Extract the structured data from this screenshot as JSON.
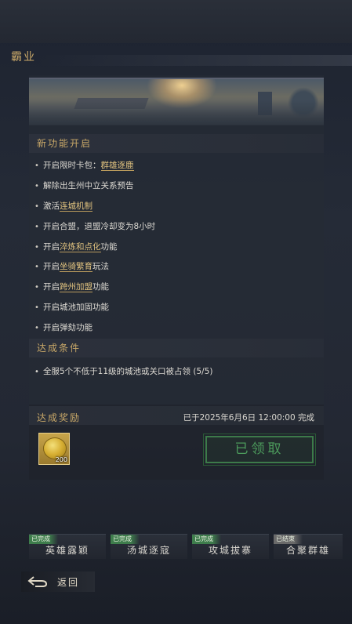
{
  "page": {
    "title": "霸业"
  },
  "features": {
    "heading": "新功能开启",
    "items": [
      {
        "text": "开启限时卡包：",
        "highlight": "群雄逐鹿",
        "suffix": ""
      },
      {
        "text": "解除出生州中立关系预告",
        "highlight": "",
        "suffix": ""
      },
      {
        "text": "激活",
        "highlight": "连城机制",
        "suffix": ""
      },
      {
        "text": "开启合盟，退盟冷却变为8小时",
        "highlight": "",
        "suffix": ""
      },
      {
        "text": "开启",
        "highlight": "淬炼和点化",
        "suffix": "功能"
      },
      {
        "text": "开启",
        "highlight": "坐骑繁育",
        "suffix": "玩法"
      },
      {
        "text": "开启",
        "highlight": "跨州加盟",
        "suffix": "功能"
      },
      {
        "text": "开启城池加固功能",
        "highlight": "",
        "suffix": ""
      },
      {
        "text": "开启弹劾功能",
        "highlight": "",
        "suffix": ""
      }
    ]
  },
  "conditions": {
    "heading": "达成条件",
    "items": [
      {
        "text": "全服5个不低于11级的城池或关口被占领",
        "progress": "(5/5)"
      }
    ]
  },
  "rewards": {
    "heading": "达成奖励",
    "status": "已于2025年6月6日 12:00:00 完成",
    "items": [
      {
        "icon": "gold-coin-icon",
        "count": "200"
      }
    ],
    "claim_label": "已领取"
  },
  "tabs": [
    {
      "badge": "已完成",
      "label": "英雄露颖"
    },
    {
      "badge": "已完成",
      "label": "汤城逐寇"
    },
    {
      "badge": "已完成",
      "label": "攻城拔寨"
    },
    {
      "badge": "已结束",
      "label": "合聚群雄"
    }
  ],
  "back": {
    "label": "返回"
  },
  "colors": {
    "gold_text": "#c9a868",
    "highlight": "#e0c27f",
    "claimed_green": "#4c9a5c",
    "badge_done": "#3e7d4c",
    "badge_ended": "#6a6a6a"
  }
}
